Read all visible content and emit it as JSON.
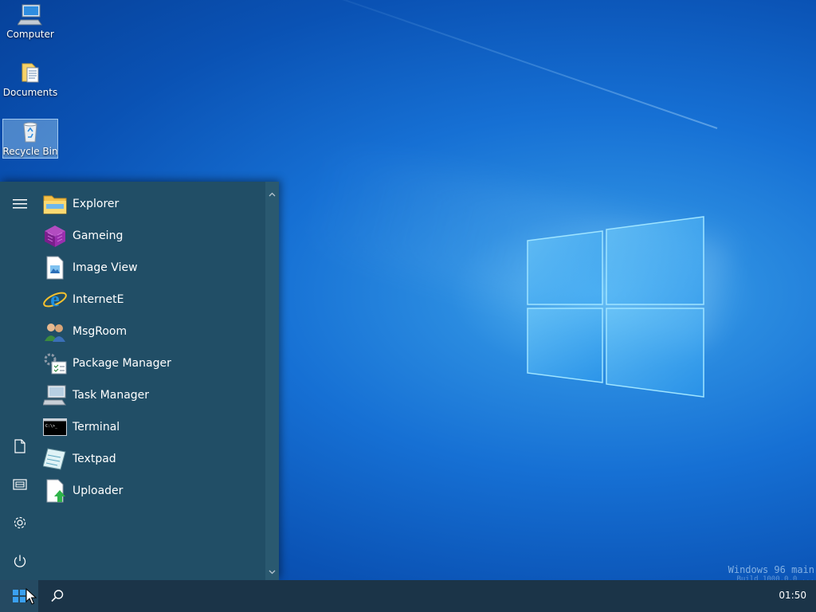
{
  "desktop": {
    "icons": [
      {
        "label": "Computer",
        "icon": "computer-icon"
      },
      {
        "label": "Documents",
        "icon": "documents-icon"
      },
      {
        "label": "Recycle Bin",
        "icon": "recycle-bin-icon",
        "selected": true
      }
    ],
    "watermark": {
      "line1": "Windows 96 main",
      "line2": "Build 1000.0.0 ..."
    }
  },
  "start_menu": {
    "apps": [
      {
        "label": "Explorer",
        "icon": "folder-icon"
      },
      {
        "label": "Gameing",
        "icon": "cube-icon"
      },
      {
        "label": "Image View",
        "icon": "image-file-icon"
      },
      {
        "label": "InternetE",
        "icon": "internet-explorer-icon"
      },
      {
        "label": "MsgRoom",
        "icon": "users-icon"
      },
      {
        "label": "Package Manager",
        "icon": "package-manager-icon"
      },
      {
        "label": "Task Manager",
        "icon": "task-manager-icon"
      },
      {
        "label": "Terminal",
        "icon": "terminal-icon"
      },
      {
        "label": "Textpad",
        "icon": "notepad-icon"
      },
      {
        "label": "Uploader",
        "icon": "upload-icon"
      }
    ],
    "rail": [
      "hamburger-icon",
      "document-icon",
      "pictures-icon",
      "settings-icon",
      "power-icon"
    ]
  },
  "taskbar": {
    "clock": "01:50"
  },
  "colors": {
    "start_menu_bg": "#214e66",
    "taskbar_bg": "#1b3448",
    "accent": "#1e90ff"
  }
}
